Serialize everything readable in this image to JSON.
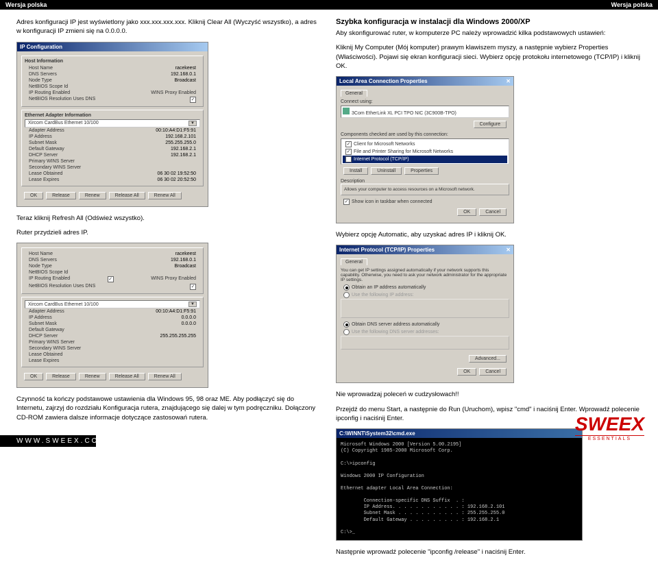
{
  "header": {
    "left": "Wersja polska",
    "right": "Wersja polska"
  },
  "left": {
    "p1": "Adres konfiguracji IP jest wyświetlony jako xxx.xxx.xxx.xxx. Kliknij Clear All (Wyczyść wszystko), a adres w konfiguracji IP zmieni się na 0.0.0.0.",
    "p2": "Teraz kliknij Refresh All (Odśwież wszystko).",
    "p3": "Ruter przydzieli adres IP.",
    "p4": "Czynność ta kończy podstawowe ustawienia dla Windows 95, 98 oraz ME. Aby podłączyć się do Internetu, zajrzyj do rozdziału Konfiguracja rutera, znajdującego się dalej w tym podręczniku. Dołączony CD-ROM zawiera dalsze informacje dotyczące zastosowań rutera.",
    "ipcfg1": {
      "title": "IP Configuration",
      "hostinfo": "Host Information",
      "host": "Host Name",
      "host_v": "racekeest",
      "dns": "DNS Servers",
      "dns_v": "192.168.0.1",
      "node": "Node Type",
      "node_v": "Broadcast",
      "scope": "NetBIOS Scope Id",
      "routing": "IP Routing Enabled",
      "wins": "WINS Proxy Enabled",
      "nbdns": "NetBIOS Resolution Uses DNS",
      "adapter_hdr": "Ethernet Adapter Information",
      "adapter": "Xircom CardBus Ethernet 10/100",
      "mac": "Adapter Address",
      "mac_v": "00:10:A4:D1:F5:91",
      "ip": "IP Address",
      "ip_v": "192.168.2.101",
      "mask": "Subnet Mask",
      "mask_v": "255.255.255.0",
      "gw": "Default Gateway",
      "gw_v": "192.168.2.1",
      "dhcp": "DHCP Server",
      "dhcp_v": "192.168.2.1",
      "pwins": "Primary WINS Server",
      "swins": "Secondary WINS Server",
      "lease1": "Lease Obtained",
      "lease1_v": "06 30 02 19:52:50",
      "lease2": "Lease Expires",
      "lease2_v": "06 30 02 20:52:50",
      "btns": [
        "OK",
        "Release",
        "Renew",
        "Release All",
        "Renew All"
      ]
    },
    "ipcfg2": {
      "host_v": "racekeest",
      "dns_v": "192.168.0.1",
      "node_v": "Broadcast",
      "adapter": "Xircom CardBus Ethernet 10/100",
      "mac_v": "00:10:A4:D1:F5:91",
      "ip_v": "0.0.0.0",
      "mask_v": "0.0.0.0",
      "gw_v": "",
      "dhcp_v": "255.255.255.255",
      "btns": [
        "OK",
        "Release",
        "Renew",
        "Release All",
        "Renew All"
      ]
    }
  },
  "right": {
    "title": "Szybka konfiguracja w instalacji dla Windows 2000/XP",
    "p1": "Aby skonfigurować ruter, w komputerze PC należy wprowadzić kilka podstawowych ustawień:",
    "p2": "Kliknij My Computer (Mój komputer) prawym klawiszem myszy, a następnie wybierz Properties (Właściwości). Pojawi się ekran konfiguracji sieci. Wybierz opcję protokołu internetowego (TCP/IP) i kliknij OK.",
    "p3": "Wybierz opcję Automatic, aby uzyskać adres IP i kliknij OK.",
    "p4": "Nie wprowadzaj poleceń w cudzysłowach!!",
    "p5": "Przejdź do menu Start, a następnie do Run (Uruchom), wpisz \"cmd\" i naciśnij Enter. Wprowadź polecenie ipconfig i naciśnij Enter.",
    "p6": "Następnie wprowadź polecenie \"ipconfig /release\" i naciśnij Enter.",
    "lan": {
      "title": "Local Area Connection Properties",
      "tab": "General",
      "connect": "Connect using:",
      "nic": "3Com EtherLink XL PCI TPO NIC (3C900B-TPO)",
      "configure": "Configure",
      "desc": "Components checked are used by this connection:",
      "items": [
        "Client for Microsoft Networks",
        "File and Printer Sharing for Microsoft Networks",
        "Internet Protocol (TCP/IP)"
      ],
      "install": "Install",
      "uninstall": "Uninstall",
      "props": "Properties",
      "desc2_h": "Description",
      "desc2": "Allows your computer to access resources on a Microsoft network.",
      "showicon": "Show icon in taskbar when connected",
      "ok": "OK",
      "cancel": "Cancel"
    },
    "tcpip": {
      "title": "Internet Protocol (TCP/IP) Properties",
      "tab": "General",
      "desc": "You can get IP settings assigned automatically if your network supports this capability. Otherwise, you need to ask your network administrator for the appropriate IP settings.",
      "auto": "Obtain an IP address automatically",
      "manual": "Use the following IP address:",
      "autod": "Obtain DNS server address automatically",
      "manuald": "Use the following DNS server addresses:",
      "adv": "Advanced...",
      "ok": "OK",
      "cancel": "Cancel"
    },
    "cmd": {
      "title": "C:\\WINNT\\System32\\cmd.exe",
      "text": "Microsoft Windows 2000 [Version 5.00.2195]\n(C) Copyright 1985-2000 Microsoft Corp.\n\nC:\\>ipconfig\n\nWindows 2000 IP Configuration\n\nEthernet adapter Local Area Connection:\n\n        Connection-specific DNS Suffix  . :\n        IP Address. . . . . . . . . . . . : 192.168.2.101\n        Subnet Mask . . . . . . . . . . . : 255.255.255.0\n        Default Gateway . . . . . . . . . : 192.168.2.1\n\nC:\\>_"
    }
  },
  "footer": {
    "url": "WWW.SWEEX.COM",
    "logo": "SWEEX",
    "sub": "ESSENTIALS"
  }
}
